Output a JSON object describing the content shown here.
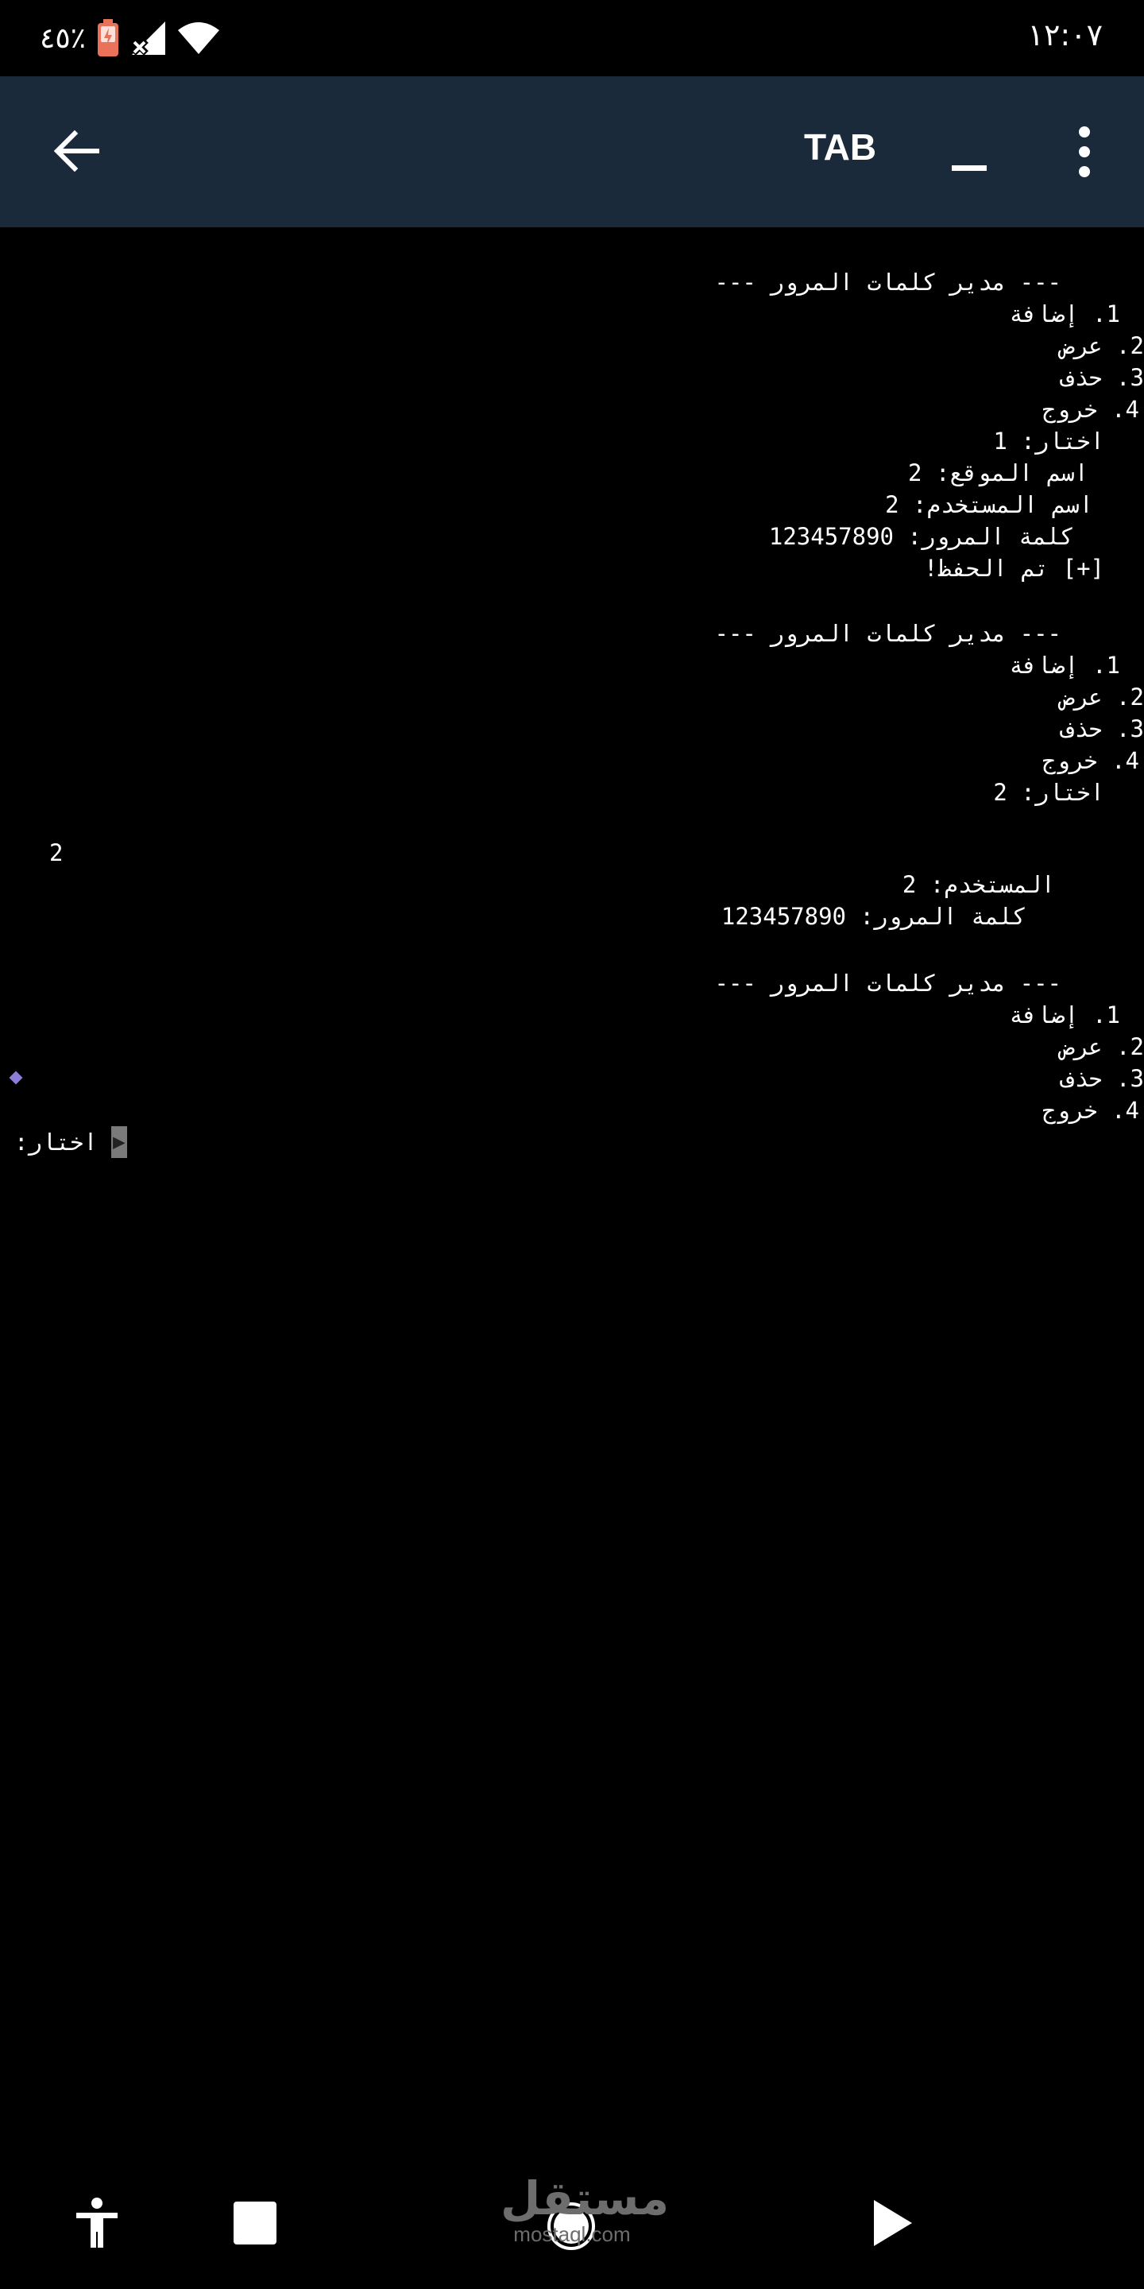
{
  "status_bar": {
    "time": "١٢:٠٧",
    "battery": "٤٥٪"
  },
  "toolbar": {
    "title": "TAB"
  },
  "terminal": {
    "lines": [
      "--- مدير كلمات المرور ---",
      "1. إضافة",
      "2. عرض",
      "3. حذف",
      "4. خروج",
      "اختار: 1",
      "اسم الموقع: 2",
      "اسم المستخدم: 2",
      "كلمة المرور: 123457890",
      "[+] تم الحفظ!",
      "--- مدير كلمات المرور ---",
      "1. إضافة",
      "2. عرض",
      "3. حذف",
      "4. خروج",
      "اختار: 2",
      "2",
      "المستخدم: 2",
      "كلمة المرور: 123457890",
      "--- مدير كلمات المرور ---",
      "1. إضافة",
      "2. عرض",
      "3. حذف",
      "4. خروج",
      "اختار:"
    ]
  },
  "watermark": {
    "arabic": "مستقل",
    "latin": "mostaql.com"
  },
  "colors": {
    "toolbar": "#1b2a3b",
    "background": "#000000",
    "battery": "#e8735a",
    "cursor": "#7a7a7a"
  },
  "icons": {
    "back": "arrow-back-icon",
    "minimize": "minimize-icon",
    "more": "more-vert-icon",
    "accessibility": "accessibility-icon",
    "stop": "stop-icon",
    "home": "home-circle-icon",
    "play": "play-icon"
  }
}
